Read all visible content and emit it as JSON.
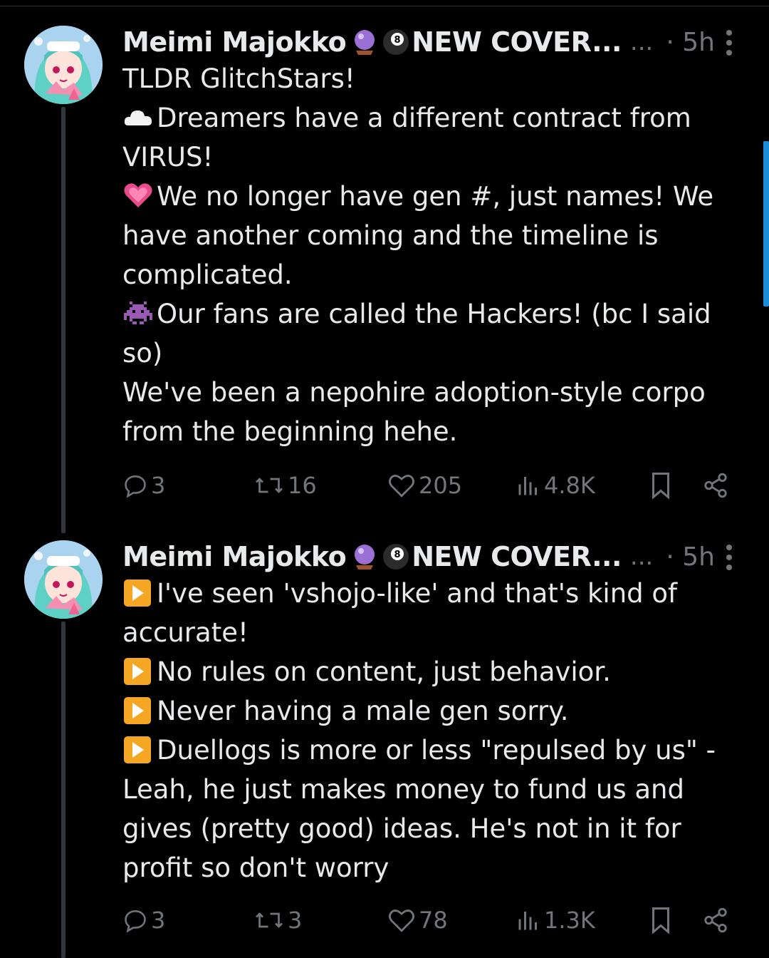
{
  "colors": {
    "background": "#000000",
    "text": "#e7e9ea",
    "muted": "#71767b",
    "accent": "#1d9bf0"
  },
  "tweets": [
    {
      "author": "Meimi Majokko",
      "badge_text": "NEW COVER...",
      "dots": "...",
      "time": "· 5h",
      "lines": [
        {
          "icon": "",
          "text": "TLDR GlitchStars!"
        },
        {
          "icon": "cloud-icon",
          "text": "Dreamers have a different contract from"
        },
        {
          "icon": "",
          "text": "VIRUS!"
        },
        {
          "icon": "heart-emoji-icon",
          "text": "We no longer have gen #, just names! We"
        },
        {
          "icon": "",
          "text": "have another coming and the timeline is"
        },
        {
          "icon": "",
          "text": "complicated."
        },
        {
          "icon": "alien-monster-icon",
          "text": "Our fans are called the Hackers! (bc I said"
        },
        {
          "icon": "",
          "text": "so)"
        },
        {
          "icon": "",
          "text": "We've been a nepohire adoption-style corpo"
        },
        {
          "icon": "",
          "text": "from the beginning hehe."
        }
      ],
      "replies": "3",
      "reposts": "16",
      "likes": "205",
      "views": "4.8K"
    },
    {
      "author": "Meimi Majokko",
      "badge_text": "NEW COVER...",
      "dots": "...",
      "time": "· 5h",
      "lines": [
        {
          "icon": "play-button-icon",
          "text": "I've seen 'vshojo-like' and that's kind of"
        },
        {
          "icon": "",
          "text": "accurate!"
        },
        {
          "icon": "play-button-icon",
          "text": "No rules on content, just behavior."
        },
        {
          "icon": "play-button-icon",
          "text": "Never having a male gen sorry."
        },
        {
          "icon": "play-button-icon",
          "text": "Duellogs is more or less \"repulsed by us\" -"
        },
        {
          "icon": "",
          "text": "Leah, he just makes money to fund us and"
        },
        {
          "icon": "",
          "text": "gives (pretty good) ideas. He's not in it for"
        },
        {
          "icon": "",
          "text": "profit so don't worry"
        }
      ],
      "replies": "3",
      "reposts": "3",
      "likes": "78",
      "views": "1.3K"
    }
  ]
}
